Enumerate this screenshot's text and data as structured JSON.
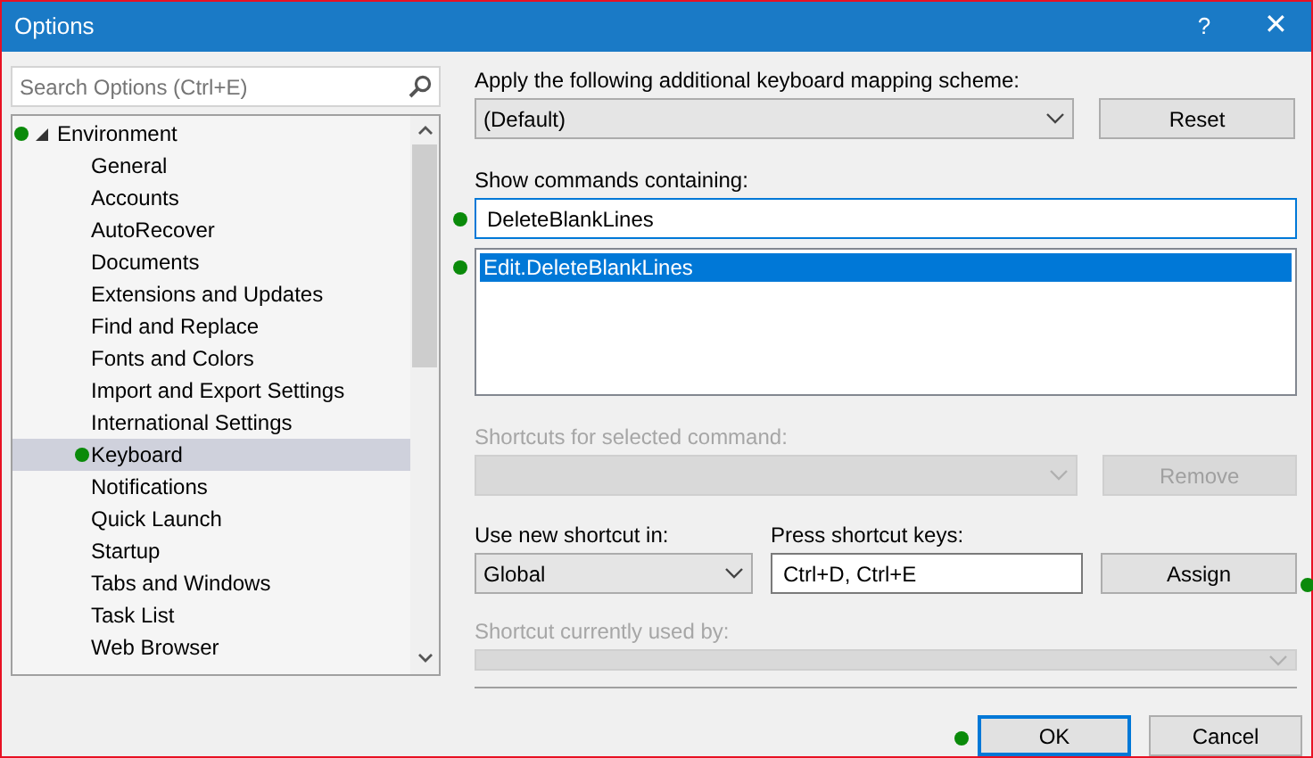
{
  "window": {
    "title": "Options",
    "buttons": [
      {
        "kind": "help",
        "label": "?"
      },
      {
        "kind": "close",
        "label": "✕"
      }
    ]
  },
  "search": {
    "placeholder": "Search Options (Ctrl+E)"
  },
  "tree": [
    {
      "label": "Environment",
      "expanded": true,
      "selected": false,
      "marked": true,
      "children": [
        {
          "label": "General",
          "selected": false,
          "marked": false
        },
        {
          "label": "Accounts",
          "selected": false,
          "marked": false
        },
        {
          "label": "AutoRecover",
          "selected": false,
          "marked": false
        },
        {
          "label": "Documents",
          "selected": false,
          "marked": false
        },
        {
          "label": "Extensions and Updates",
          "selected": false,
          "marked": false
        },
        {
          "label": "Find and Replace",
          "selected": false,
          "marked": false
        },
        {
          "label": "Fonts and Colors",
          "selected": false,
          "marked": false
        },
        {
          "label": "Import and Export Settings",
          "selected": false,
          "marked": false
        },
        {
          "label": "International Settings",
          "selected": false,
          "marked": false
        },
        {
          "label": "Keyboard",
          "selected": true,
          "marked": true
        },
        {
          "label": "Notifications",
          "selected": false,
          "marked": false
        },
        {
          "label": "Quick Launch",
          "selected": false,
          "marked": false
        },
        {
          "label": "Startup",
          "selected": false,
          "marked": false
        },
        {
          "label": "Tabs and Windows",
          "selected": false,
          "marked": false
        },
        {
          "label": "Task List",
          "selected": false,
          "marked": false
        },
        {
          "label": "Web Browser",
          "selected": false,
          "marked": false
        }
      ]
    }
  ],
  "mapping_scheme": {
    "label": "Apply the following additional keyboard mapping scheme:",
    "value": "(Default)",
    "disabled": false
  },
  "reset_button": {
    "label": "Reset",
    "disabled": false
  },
  "command_filter": {
    "label": "Show commands containing:",
    "value": "DeleteBlankLines",
    "marked": true
  },
  "commands": [
    {
      "label": "Edit.DeleteBlankLines",
      "selected": true,
      "marked": true
    }
  ],
  "current_shortcuts": {
    "label": "Shortcuts for selected command:",
    "disabled": true
  },
  "remove_button": {
    "label": "Remove",
    "disabled": true
  },
  "scope": {
    "label": "Use new shortcut in:",
    "value": "Global",
    "disabled": false
  },
  "shortcut_keys": {
    "label": "Press shortcut keys:",
    "value": "Ctrl+D, Ctrl+E"
  },
  "assign_button": {
    "label": "Assign",
    "disabled": false,
    "marked": true
  },
  "used_by": {
    "label": "Shortcut currently used by:",
    "disabled": true
  },
  "footer_buttons": [
    {
      "label": "OK",
      "default": true,
      "marked": true
    },
    {
      "label": "Cancel",
      "default": false,
      "marked": false
    }
  ]
}
